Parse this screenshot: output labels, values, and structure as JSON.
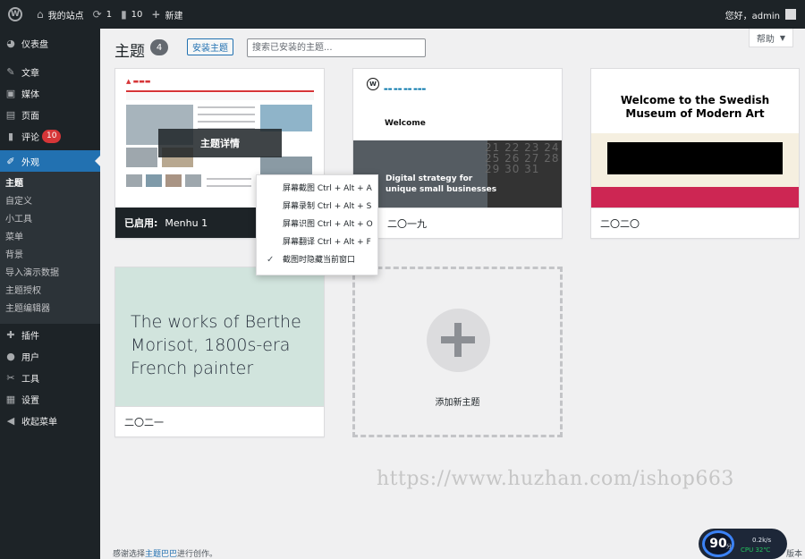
{
  "adminbar": {
    "logo": "W",
    "site_name": "我的站点",
    "updates_count": "1",
    "comments_count": "10",
    "new_label": "新建",
    "greeting": "您好，admin"
  },
  "sidebar": {
    "items": [
      {
        "icon": "dashboard-icon",
        "label": "仪表盘"
      },
      {
        "icon": "pin-icon",
        "label": "文章"
      },
      {
        "icon": "media-icon",
        "label": "媒体"
      },
      {
        "icon": "page-icon",
        "label": "页面"
      },
      {
        "icon": "comment-icon",
        "label": "评论",
        "badge": "10"
      },
      {
        "icon": "brush-icon",
        "label": "外观"
      },
      {
        "icon": "plugin-icon",
        "label": "插件"
      },
      {
        "icon": "user-icon",
        "label": "用户"
      },
      {
        "icon": "wrench-icon",
        "label": "工具"
      },
      {
        "icon": "settings-icon",
        "label": "设置"
      },
      {
        "icon": "collapse-icon",
        "label": "收起菜单"
      }
    ],
    "submenu": [
      "主题",
      "自定义",
      "小工具",
      "菜单",
      "背景",
      "导入演示数据",
      "主题授权",
      "主题编辑器"
    ]
  },
  "main": {
    "help_label": "帮助",
    "title": "主题",
    "count": "4",
    "install_label": "安装主题",
    "search_placeholder": "搜索已安装的主题..."
  },
  "themes": [
    {
      "name": "Menhu 1",
      "active_label": "已启用:",
      "overlay": "主题详情"
    },
    {
      "name": "二〇一九",
      "shot_welcome": "Welcome",
      "shot_tagline_1": "Digital strategy for",
      "shot_tagline_2": "unique small businesses",
      "shot_numbers": "21 22 23 24 25 26 27 28 29 30 31"
    },
    {
      "name": "二〇二〇",
      "shot_title_1": "Welcome to the Swedish",
      "shot_title_2": "Museum of Modern Art"
    },
    {
      "name": "二〇二一",
      "shot_text_1": "The works of Berthe",
      "shot_text_2": "Morisot, 1800s-era",
      "shot_text_3": "French painter"
    }
  ],
  "add_new_label": "添加新主题",
  "context_menu": [
    {
      "label": "屏幕截图 Ctrl + Alt + A",
      "checked": false
    },
    {
      "label": "屏幕录制 Ctrl + Alt + S",
      "checked": false
    },
    {
      "label": "屏幕识图 Ctrl + Alt + O",
      "checked": false
    },
    {
      "label": "屏幕翻译 Ctrl + Alt + F",
      "checked": false
    },
    {
      "label": "截图时隐藏当前窗口",
      "checked": true
    }
  ],
  "watermark": "https://www.huzhan.com/ishop663",
  "footer": {
    "text_before": "感谢选择",
    "link": "主题巴巴",
    "text_after": "进行创作。",
    "version": "版本"
  },
  "speed_widget": {
    "score": "90",
    "unit": "分",
    "rate": "0.2k/s",
    "cpu": "CPU 32℃"
  },
  "colors": {
    "adminbar_bg": "#1d2327",
    "accent": "#2271b1",
    "badge": "#d63638"
  }
}
